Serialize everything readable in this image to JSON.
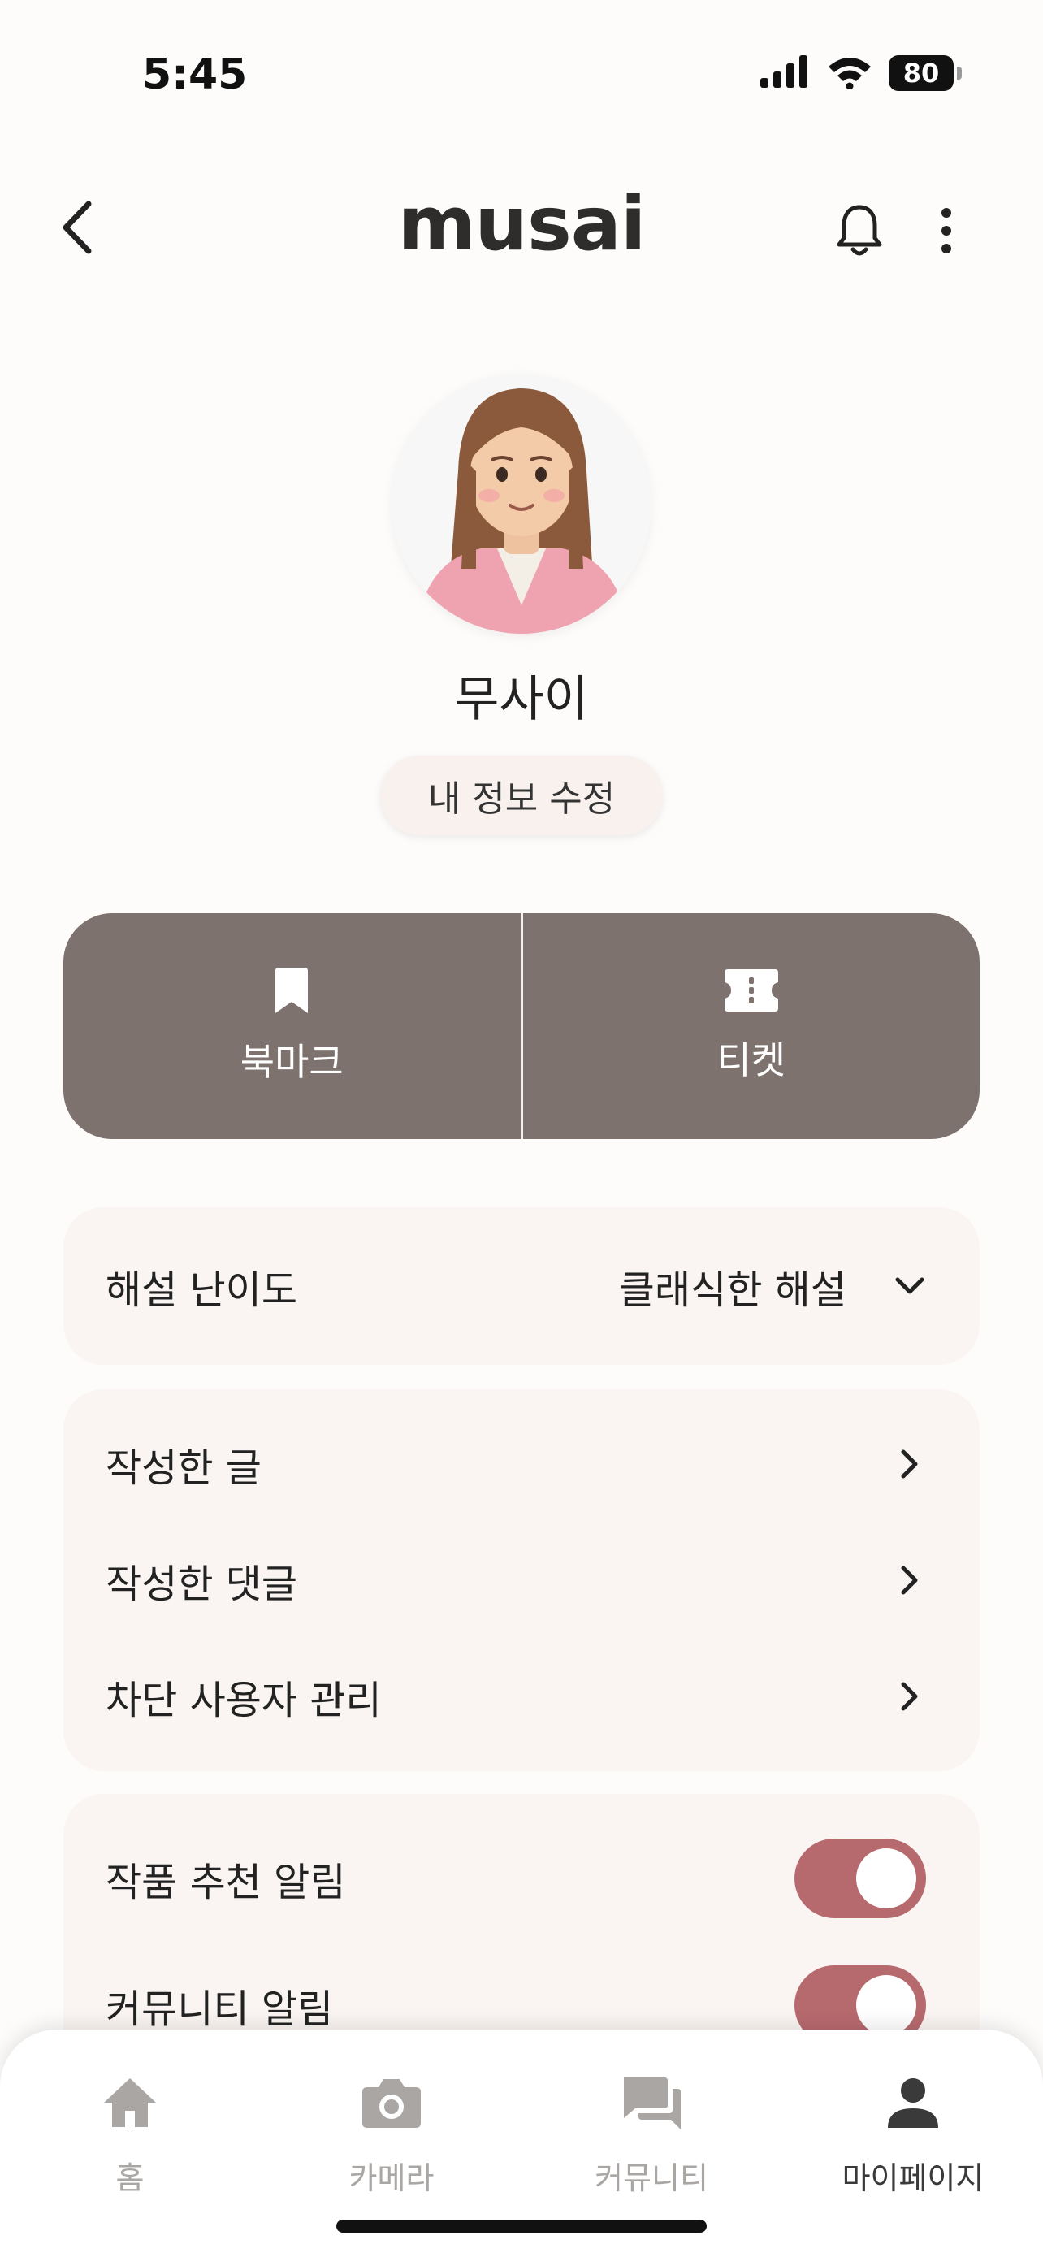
{
  "status_bar": {
    "time": "5:45",
    "battery": "80"
  },
  "header": {
    "title": "musai",
    "icons": {
      "back": "chevron-left-icon",
      "bell": "bell-icon",
      "more": "more-vertical-icon"
    }
  },
  "profile": {
    "name": "무사이",
    "edit_label": "내 정보 수정"
  },
  "actions": {
    "bookmark_label": "북마크",
    "ticket_label": "티켓"
  },
  "difficulty": {
    "label": "해설 난이도",
    "value": "클래식한 해설"
  },
  "menu": {
    "items": [
      {
        "label": "작성한 글"
      },
      {
        "label": "작성한 댓글"
      },
      {
        "label": "차단 사용자 관리"
      }
    ]
  },
  "notifications": {
    "items": [
      {
        "label": "작품 추천 알림",
        "enabled": true
      },
      {
        "label": "커뮤니티 알림",
        "enabled": true
      }
    ]
  },
  "bottom_nav": {
    "items": [
      {
        "label": "홈",
        "icon": "home-icon",
        "active": false
      },
      {
        "label": "카메라",
        "icon": "camera-icon",
        "active": false
      },
      {
        "label": "커뮤니티",
        "icon": "chat-icon",
        "active": false
      },
      {
        "label": "마이페이지",
        "icon": "person-icon",
        "active": true
      }
    ]
  },
  "colors": {
    "accent": "#7D726E",
    "toggle_on": "#B76A6E",
    "card_bg": "#FAF5F2"
  }
}
